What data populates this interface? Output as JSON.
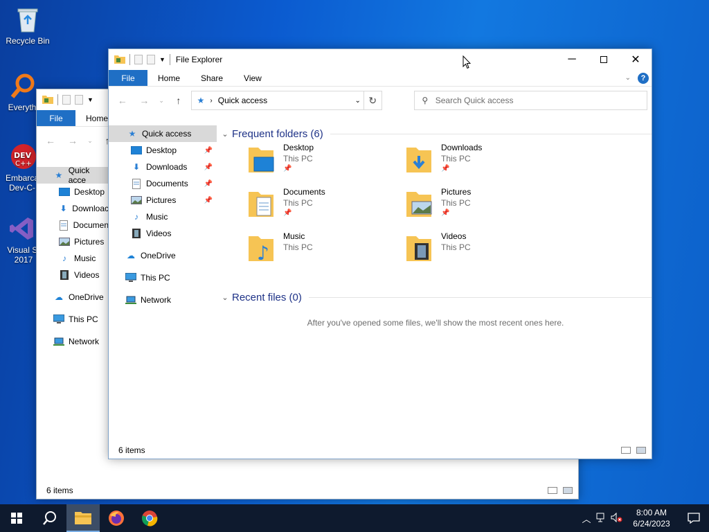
{
  "desktop": {
    "icons": [
      {
        "label": "Recycle Bin",
        "icon": "recycle-bin-icon"
      },
      {
        "label": "Everyth",
        "icon": "everything-search-icon"
      },
      {
        "label": "Embarca Dev-C-",
        "icon": "devcpp-icon"
      },
      {
        "label": "Visual St 2017",
        "icon": "visual-studio-icon"
      }
    ]
  },
  "back_window": {
    "ribbon": {
      "file": "File",
      "home": "Home"
    },
    "nav": [
      "Quick acce",
      "Desktop",
      "Downloac",
      "Documen",
      "Pictures",
      "Music",
      "Videos",
      "OneDrive",
      "This PC",
      "Network"
    ],
    "status": "6 items"
  },
  "window": {
    "title": "File Explorer",
    "ribbon": {
      "file": "File",
      "home": "Home",
      "share": "Share",
      "view": "View"
    },
    "address": "Quick access",
    "search_placeholder": "Search Quick access",
    "nav": {
      "quick_access": "Quick access",
      "pinned": [
        "Desktop",
        "Downloads",
        "Documents",
        "Pictures"
      ],
      "unpinned": [
        "Music",
        "Videos"
      ],
      "onedrive": "OneDrive",
      "this_pc": "This PC",
      "network": "Network"
    },
    "frequent": {
      "header": "Frequent folders (6)",
      "folders": [
        {
          "name": "Desktop",
          "location": "This PC",
          "pinned": true
        },
        {
          "name": "Downloads",
          "location": "This PC",
          "pinned": true
        },
        {
          "name": "Documents",
          "location": "This PC",
          "pinned": true
        },
        {
          "name": "Pictures",
          "location": "This PC",
          "pinned": true
        },
        {
          "name": "Music",
          "location": "This PC",
          "pinned": false
        },
        {
          "name": "Videos",
          "location": "This PC",
          "pinned": false
        }
      ]
    },
    "recent": {
      "header": "Recent files (0)",
      "empty": "After you've opened some files, we'll show the most recent ones here."
    },
    "status": "6 items"
  },
  "taskbar": {
    "time": "8:00 AM",
    "date": "6/24/2023"
  },
  "colors": {
    "accent": "#1f6fc5",
    "folder": "#f6c454",
    "taskbar": "#0e1a2e"
  }
}
